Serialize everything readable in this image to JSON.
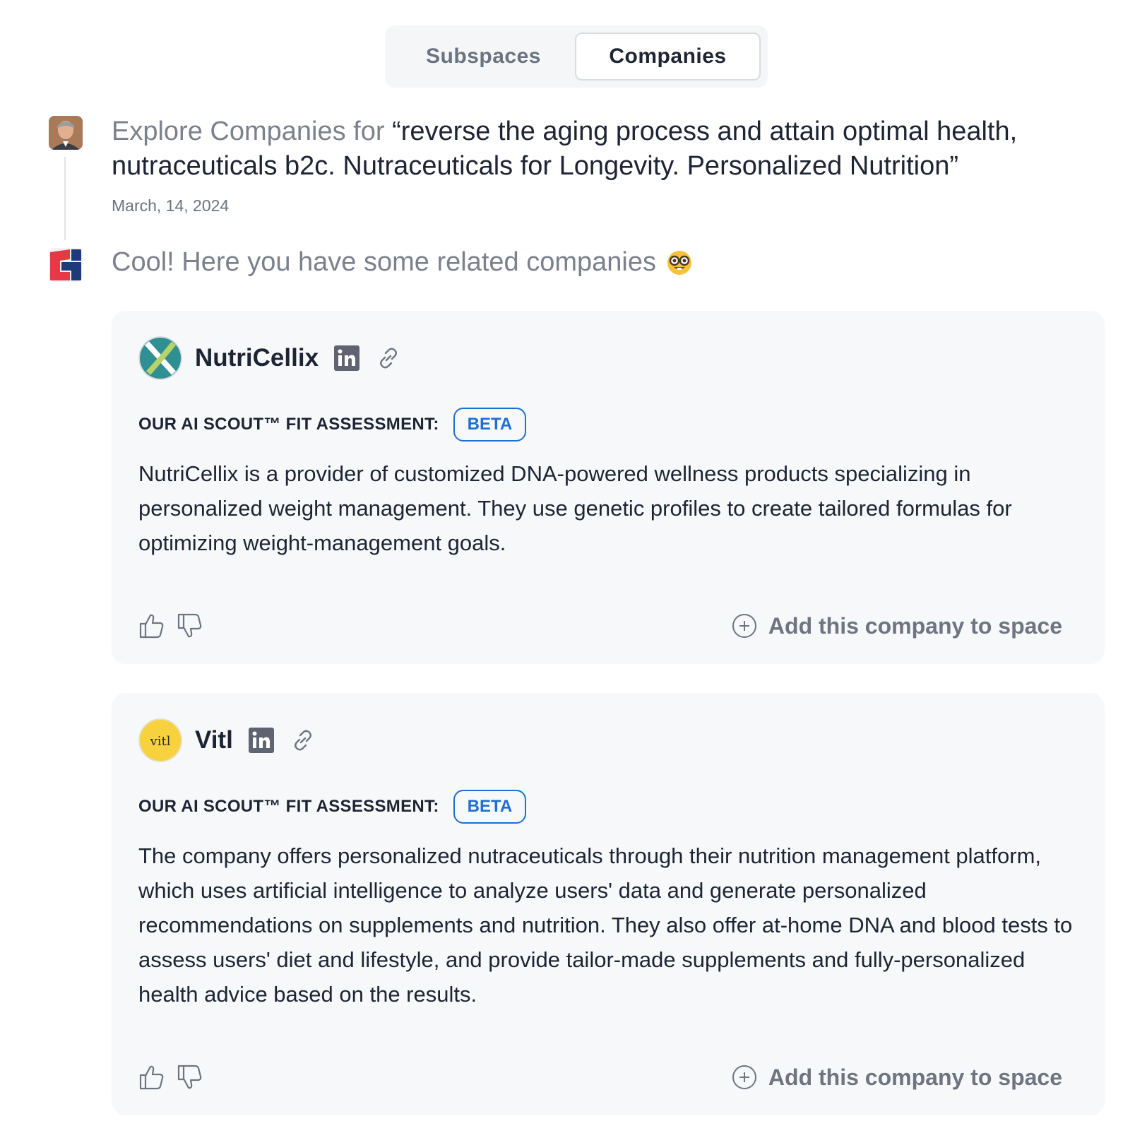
{
  "tabs": [
    {
      "label": "Subspaces",
      "active": false
    },
    {
      "label": "Companies",
      "active": true
    }
  ],
  "query": {
    "prefix": "Explore Companies for",
    "text": "“reverse the aging process and attain optimal health, nutraceuticals b2c. Nutraceuticals for Longevity. Personalized Nutrition”",
    "date": "March, 14, 2024"
  },
  "bot": {
    "message": "Cool! Here you have some related companies"
  },
  "companies": [
    {
      "name": "NutriCellix",
      "assessment_label": "OUR AI SCOUT™ FIT ASSESSMENT:",
      "badge": "BETA",
      "description": "NutriCellix is a provider of customized DNA-powered wellness products specializing in personalized weight management. They use genetic profiles to create tailored formulas for optimizing weight-management goals.",
      "add_label": "Add this company to space"
    },
    {
      "name": "Vitl",
      "logo_text": "vitl",
      "assessment_label": "OUR AI SCOUT™ FIT ASSESSMENT:",
      "badge": "BETA",
      "description": "The company offers personalized nutraceuticals through their nutrition management platform, which uses artificial intelligence to analyze users' data and generate personalized recommendations on supplements and nutrition. They also offer at-home DNA and blood tests to assess users' diet and lifestyle, and provide tailor-made supplements and fully-personalized health advice based on the results.",
      "add_label": "Add this company to space"
    }
  ],
  "colors": {
    "accent_blue": "#1f6fd1",
    "card_bg": "#f7f8fa",
    "muted_text": "#7b818c",
    "linkedin_gray": "#5f6470",
    "vitl_yellow": "#f7d23e",
    "nutricellix_teal": "#2f8f93"
  },
  "icons": [
    "user-avatar",
    "bot-logo",
    "nerd-face-emoji",
    "linkedin-icon",
    "link-icon",
    "thumbs-up-icon",
    "thumbs-down-icon",
    "plus-circle-icon"
  ]
}
